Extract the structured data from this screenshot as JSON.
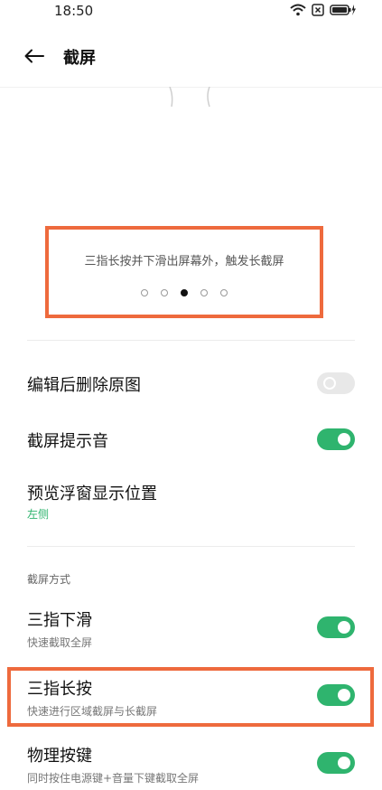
{
  "status_bar": {
    "time": "18:50",
    "icons": [
      "wifi-icon",
      "sim-off-icon",
      "battery-charging-icon"
    ]
  },
  "header": {
    "back_icon": "arrow-left-icon",
    "title": "截屏"
  },
  "tutorial": {
    "text": "三指长按并下滑出屏幕外，触发长截屏",
    "page_count": 5,
    "active_page": 3
  },
  "settings": {
    "delete_original": {
      "title": "编辑后删除原图",
      "enabled": false
    },
    "sound": {
      "title": "截屏提示音",
      "enabled": true
    },
    "preview_position": {
      "title": "预览浮窗显示位置",
      "value": "左侧"
    }
  },
  "methods": {
    "section_title": "截屏方式",
    "three_finger_swipe": {
      "title": "三指下滑",
      "subtitle": "快速截取全屏",
      "enabled": true
    },
    "three_finger_hold": {
      "title": "三指长按",
      "subtitle": "快速进行区域截屏与长截屏",
      "enabled": true
    },
    "physical_keys": {
      "title": "物理按键",
      "subtitle": "同时按住电源键+音量下键截取全屏",
      "enabled": true
    }
  },
  "colors": {
    "accent": "#2fb46e",
    "highlight": "#ee6a3d"
  }
}
